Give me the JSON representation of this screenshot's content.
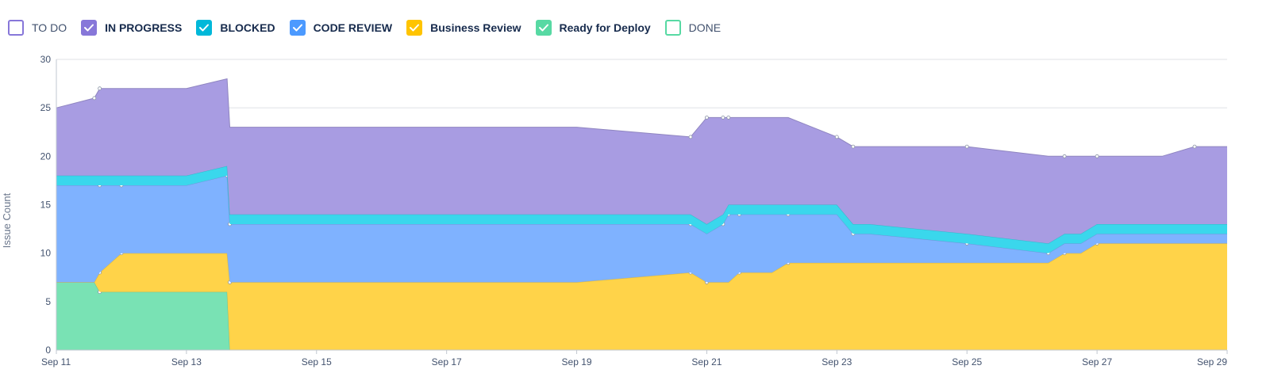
{
  "legend": [
    {
      "label": "TO DO",
      "color": "#8777d9",
      "checked": false
    },
    {
      "label": "IN PROGRESS",
      "color": "#8777d9",
      "checked": true
    },
    {
      "label": "BLOCKED",
      "color": "#00b8d9",
      "checked": true
    },
    {
      "label": "CODE REVIEW",
      "color": "#4c9aff",
      "checked": true
    },
    {
      "label": "Business Review",
      "color": "#ffc400",
      "checked": true
    },
    {
      "label": "Ready for Deploy",
      "color": "#57d9a3",
      "checked": true
    },
    {
      "label": "DONE",
      "color": "#57d9a3",
      "checked": false
    }
  ],
  "chart_data": {
    "type": "area",
    "stacked": true,
    "ylabel": "Issue Count",
    "xlabel": "",
    "ylim": [
      0,
      30
    ],
    "yticks": [
      0,
      5,
      10,
      15,
      20,
      25,
      30
    ],
    "xlim": [
      "Sep 11",
      "Sep 29"
    ],
    "xticks": [
      "Sep 11",
      "Sep 13",
      "Sep 15",
      "Sep 17",
      "Sep 19",
      "Sep 21",
      "Sep 23",
      "Sep 25",
      "Sep 27",
      "Sep 29"
    ],
    "grid": true,
    "x": [
      "Sep 11",
      "Sep 11 14:00",
      "Sep 11 16:00",
      "Sep 12",
      "Sep 13",
      "Sep 13 15:00",
      "Sep 13 16:00",
      "Sep 14",
      "Sep 15",
      "Sep 19",
      "Sep 20 18:00",
      "Sep 21",
      "Sep 21 06:00",
      "Sep 21 08:00",
      "Sep 21 12:00",
      "Sep 22",
      "Sep 22 06:00",
      "Sep 23",
      "Sep 23 06:00",
      "Sep 23 12:00",
      "Sep 25",
      "Sep 26 06:00",
      "Sep 26 12:00",
      "Sep 26 18:00",
      "Sep 27",
      "Sep 28",
      "Sep 28 12:00",
      "Sep 29"
    ],
    "series": [
      {
        "name": "Ready for Deploy",
        "color": "#79e2b4",
        "values": [
          7,
          7,
          6,
          6,
          6,
          6,
          0,
          0,
          0,
          0,
          0,
          0,
          0,
          0,
          0,
          0,
          0,
          0,
          0,
          0,
          0,
          0,
          0,
          0,
          0,
          0,
          0,
          0
        ]
      },
      {
        "name": "Business Review",
        "color": "#ffd349",
        "values": [
          0,
          0,
          2,
          4,
          4,
          4,
          7,
          7,
          7,
          7,
          8,
          7,
          7,
          7,
          8,
          8,
          9,
          9,
          9,
          9,
          9,
          9,
          10,
          10,
          11,
          11,
          11,
          11
        ]
      },
      {
        "name": "CODE REVIEW",
        "color": "#7fb2ff",
        "values": [
          10,
          10,
          9,
          7,
          7,
          8,
          6,
          6,
          6,
          6,
          5,
          5,
          6,
          7,
          6,
          6,
          5,
          5,
          3,
          3,
          2,
          1,
          1,
          1,
          1,
          1,
          1,
          1
        ]
      },
      {
        "name": "BLOCKED",
        "color": "#3ad7ec",
        "values": [
          1,
          1,
          1,
          1,
          1,
          1,
          1,
          1,
          1,
          1,
          1,
          1,
          1,
          1,
          1,
          1,
          1,
          1,
          1,
          1,
          1,
          1,
          1,
          1,
          1,
          1,
          1,
          1
        ]
      },
      {
        "name": "IN PROGRESS",
        "color": "#a89ce2",
        "values": [
          7,
          8,
          9,
          9,
          9,
          9,
          9,
          9,
          9,
          9,
          8,
          11,
          10,
          9,
          9,
          9,
          9,
          7,
          8,
          8,
          9,
          9,
          8,
          8,
          7,
          7,
          8,
          8
        ]
      }
    ]
  }
}
